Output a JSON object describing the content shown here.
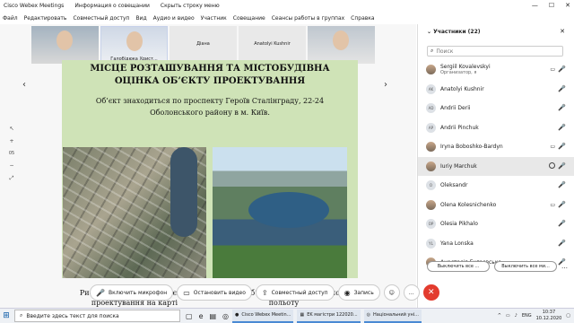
{
  "window": {
    "title": "Cisco Webex Meetings",
    "info_tab": "Информация о совещании",
    "hide_menu": "Скрыть строку меню"
  },
  "menu": [
    "Файл",
    "Редактировать",
    "Совместный доступ",
    "Вид",
    "Аудио и видео",
    "Участник",
    "Совещание",
    "Сеансы работы в группах",
    "Справка"
  ],
  "thumbnails": [
    {
      "name": ""
    },
    {
      "name": "Галобідюка Христ..."
    },
    {
      "name": "Діана"
    },
    {
      "name": "Anatolyi Kushnir"
    },
    {
      "name": ""
    }
  ],
  "slide": {
    "title_line1": "МІСЦЕ РОЗТАШУВАННЯ ТА МІСТОБУДІВНА",
    "title_line2": "ОЦІНКА ОБ’ЄКТУ  ПРОЕКТУВАННЯ",
    "address": "Об’єкт знаходиться по проспекту Героїв Сталінграду, 22-24 Оболонського району в м. Київ.",
    "caption_left": "Рис.2. Розташування об’єкту проектування на карті",
    "caption_right": "Рис.3. Об’єкт з висоти пташиного польоту"
  },
  "zoom_level": "05",
  "participants_panel": {
    "title": "Участники (22)",
    "search_placeholder": "Поиск",
    "people": [
      {
        "initials": "",
        "photo": true,
        "name": "Sergiil Kovalevskyi",
        "role": "Организатор, я",
        "camera": true,
        "mic": true
      },
      {
        "initials": "AK",
        "photo": false,
        "name": "Anatolyi Kushnir",
        "role": "",
        "camera": false,
        "mic": true
      },
      {
        "initials": "AD",
        "photo": false,
        "name": "Andrii Derii",
        "role": "",
        "camera": false,
        "mic": true
      },
      {
        "initials": "AP",
        "photo": false,
        "name": "Andrii Pinchuk",
        "role": "",
        "camera": false,
        "mic": true
      },
      {
        "initials": "",
        "photo": true,
        "name": "Iryna Boboshko-Bardyn",
        "role": "",
        "camera": true,
        "mic": true
      },
      {
        "initials": "",
        "photo": true,
        "name": "Iuriy Marchuk",
        "role": "",
        "camera": false,
        "mic": true,
        "selected": true,
        "chat": true
      },
      {
        "initials": "O",
        "photo": false,
        "name": "Oleksandr",
        "role": "",
        "camera": false,
        "mic": true
      },
      {
        "initials": "",
        "photo": true,
        "name": "Olena Kolesnichenko",
        "role": "",
        "camera": true,
        "mic": true
      },
      {
        "initials": "OP",
        "photo": false,
        "name": "Olesia Pikhalo",
        "role": "",
        "camera": false,
        "mic": true
      },
      {
        "initials": "YL",
        "photo": false,
        "name": "Yana Lonska",
        "role": "",
        "camera": false,
        "mic": true
      },
      {
        "initials": "",
        "photo": true,
        "name": "Анастасія Бугаєвська",
        "role": "",
        "camera": false,
        "mic": true
      }
    ],
    "mute_all": "Выключить все ...",
    "unmute_all": "Выключить все ми..."
  },
  "controls": {
    "mic": "Включить микрофон",
    "video": "Остановить видео",
    "share": "Совместный доступ",
    "record": "Запись"
  },
  "taskbar": {
    "search_placeholder": "Введите здесь текст для поиска",
    "apps": [
      "Cisco Webex Meetin...",
      "EK магістри 122020...",
      "Національний уні..."
    ],
    "lang": "ENG",
    "time": "10:37",
    "date": "10.12.2020"
  }
}
